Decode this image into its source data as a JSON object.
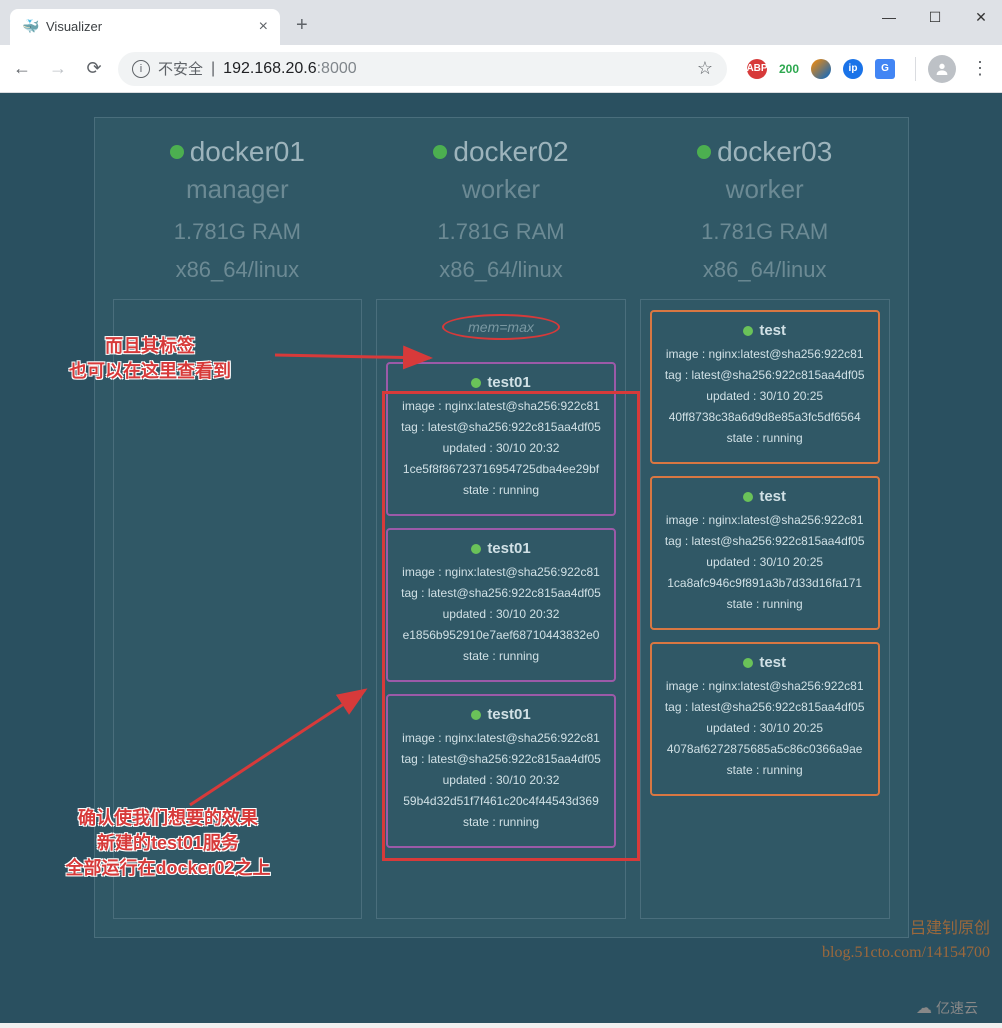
{
  "browser": {
    "tab_title": "Visualizer",
    "insecure_label": "不安全",
    "url_host": "192.168.20.6",
    "url_port": ":8000",
    "ext_abp": "ABP",
    "ext_200": "200",
    "ext_ip": "ip",
    "ext_gt": "G"
  },
  "nodes": [
    {
      "name": "docker01",
      "role": "manager",
      "ram": "1.781G RAM",
      "arch": "x86_64/linux",
      "label": "",
      "services": []
    },
    {
      "name": "docker02",
      "role": "worker",
      "ram": "1.781G RAM",
      "arch": "x86_64/linux",
      "label": "mem=max",
      "services": [
        {
          "name": "test01",
          "image": "image : nginx:latest@sha256:922c81",
          "tag": "tag : latest@sha256:922c815aa4df05",
          "updated": "updated : 30/10 20:32",
          "id": "1ce5f8f86723716954725dba4ee29bf",
          "state": "state : running",
          "color": "purple"
        },
        {
          "name": "test01",
          "image": "image : nginx:latest@sha256:922c81",
          "tag": "tag : latest@sha256:922c815aa4df05",
          "updated": "updated : 30/10 20:32",
          "id": "e1856b952910e7aef68710443832e0",
          "state": "state : running",
          "color": "purple"
        },
        {
          "name": "test01",
          "image": "image : nginx:latest@sha256:922c81",
          "tag": "tag : latest@sha256:922c815aa4df05",
          "updated": "updated : 30/10 20:32",
          "id": "59b4d32d51f7f461c20c4f44543d369",
          "state": "state : running",
          "color": "purple"
        }
      ]
    },
    {
      "name": "docker03",
      "role": "worker",
      "ram": "1.781G RAM",
      "arch": "x86_64/linux",
      "label": "",
      "services": [
        {
          "name": "test",
          "image": "image : nginx:latest@sha256:922c81",
          "tag": "tag : latest@sha256:922c815aa4df05",
          "updated": "updated : 30/10 20:25",
          "id": "40ff8738c38a6d9d8e85a3fc5df6564",
          "state": "state : running",
          "color": "orange"
        },
        {
          "name": "test",
          "image": "image : nginx:latest@sha256:922c81",
          "tag": "tag : latest@sha256:922c815aa4df05",
          "updated": "updated : 30/10 20:25",
          "id": "1ca8afc946c9f891a3b7d33d16fa171",
          "state": "state : running",
          "color": "orange"
        },
        {
          "name": "test",
          "image": "image : nginx:latest@sha256:922c81",
          "tag": "tag : latest@sha256:922c815aa4df05",
          "updated": "updated : 30/10 20:25",
          "id": "4078af6272875685a5c86c0366a9ae",
          "state": "state : running",
          "color": "orange"
        }
      ]
    }
  ],
  "annotations": {
    "top_line1": "而且其标签",
    "top_line2": "也可以在这里查看到",
    "bottom_line1": "确认使我们想要的效果",
    "bottom_line2": "新建的test01服务",
    "bottom_line3": "全部运行在docker02之上"
  },
  "watermark": {
    "line1": "吕建钊原创",
    "line2": "blog.51cto.com/14154700",
    "logo": "亿速云"
  }
}
